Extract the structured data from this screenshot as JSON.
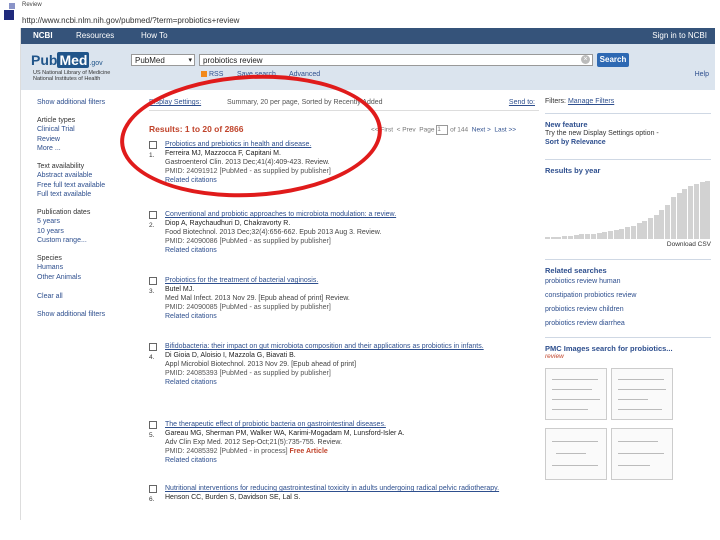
{
  "slide": {
    "top_text": "Review",
    "url_text": "http://www.ncbi.nlm.nih.gov/pubmed/?term=probiotics+review"
  },
  "ncbi_bar": {
    "logo": "NCBI",
    "resources": "Resources",
    "how_to": "How To",
    "sign_in": "Sign in to NCBI"
  },
  "header": {
    "logo_pub": "Pub",
    "logo_med": "Med",
    "logo_gov": ".gov",
    "nlm_text": "US National Library of Medicine National Institutes of Health",
    "database": "PubMed",
    "search_value": "probiotics review",
    "search_button": "Search",
    "rss": "RSS",
    "save_search": "Save search",
    "advanced": "Advanced",
    "help": "Help"
  },
  "sidebar": {
    "show_filters": "Show additional filters",
    "article_types_title": "Article types",
    "article_types": [
      "Clinical Trial",
      "Review",
      "More ..."
    ],
    "text_avail_title": "Text availability",
    "text_avail": [
      "Abstract available",
      "Free full text available",
      "Full text available"
    ],
    "pub_dates_title": "Publication dates",
    "pub_dates": [
      "5 years",
      "10 years",
      "Custom range..."
    ],
    "species_title": "Species",
    "species": [
      "Humans",
      "Other Animals"
    ],
    "clear_all": "Clear all",
    "show_filters_bottom": "Show additional filters"
  },
  "main": {
    "display_settings": "Display Settings:",
    "display_desc": "Summary, 20 per page, Sorted by Recently Added",
    "send_to": "Send to:",
    "results_count": "Results: 1 to 20 of 2866",
    "pager": {
      "first": "<< First",
      "prev": "< Prev",
      "page_label": "Page",
      "page_value": "1",
      "of": "of 144",
      "next": "Next >",
      "last": "Last >>"
    },
    "results": [
      {
        "num": "1.",
        "title": "Probiotics and prebiotics in health and disease.",
        "authors": "Ferreira MJ, Mazzocca F, Capitani M.",
        "cite": "Gastroenterol Clin. 2013 Dec;41(4):409-423. Review.",
        "pmid": "PMID: 24091912 [PubMed - as supplied by publisher]",
        "related": "Related citations",
        "free": ""
      },
      {
        "num": "2.",
        "title": "Conventional and probiotic approaches to microbiota modulation: a review.",
        "authors": "Diop A, Raychaudhuri D, Chakravorty R.",
        "cite": "Food Biotechnol. 2013 Dec;32(4):656-662. Epub 2013 Aug 3. Review.",
        "pmid": "PMID: 24090086 [PubMed - as supplied by publisher]",
        "related": "Related citations",
        "free": ""
      },
      {
        "num": "3.",
        "title": "Probiotics for the treatment of bacterial vaginosis.",
        "authors": "Butel MJ.",
        "cite": "Med Mal Infect. 2013 Nov 29. [Epub ahead of print] Review.",
        "pmid": "PMID: 24090085 [PubMed - as supplied by publisher]",
        "related": "Related citations",
        "free": ""
      },
      {
        "num": "4.",
        "title": "Bifidobacteria: their impact on gut microbiota composition and their applications as probiotics in infants.",
        "authors": "Di Gioia D, Aloisio I, Mazzola G, Biavati B.",
        "cite": "Appl Microbiol Biotechnol. 2013 Nov 29. [Epub ahead of print]",
        "pmid": "PMID: 24085393 [PubMed - as supplied by publisher]",
        "related": "Related citations",
        "free": ""
      },
      {
        "num": "5.",
        "title": "The therapeutic effect of probiotic bacteria on gastrointestinal diseases.",
        "authors": "Gareau MG, Sherman PM, Walker WA, Karimi-Mogadam M, Lunsford-Isler A.",
        "cite": "Adv Clin Exp Med. 2012 Sep-Oct;21(5):735-755. Review.",
        "pmid": "PMID: 24085392 [PubMed - in process]",
        "related": "Related citations",
        "free": "Free Article"
      },
      {
        "num": "6.",
        "title": "Nutritional interventions for reducing gastrointestinal toxicity in adults undergoing radical pelvic radiotherapy.",
        "authors": "Henson CC, Burden S, Davidson SE, Lal S.",
        "cite": "",
        "pmid": "",
        "related": "",
        "free": ""
      }
    ]
  },
  "right": {
    "filters_label": "Filters:",
    "manage_filters": "Manage Filters",
    "new_feature_title": "New feature",
    "new_feature_text": "Try the new Display Settings option -",
    "new_feature_link": "Sort by Relevance",
    "results_by_year_title": "Results by year",
    "download_csv": "Download CSV",
    "year_counts": [
      3,
      4,
      4,
      5,
      6,
      7,
      8,
      8,
      9,
      10,
      12,
      14,
      16,
      18,
      20,
      23,
      27,
      31,
      36,
      42,
      50,
      58,
      72,
      80,
      86,
      91,
      95,
      98,
      100
    ],
    "related_searches_title": "Related searches",
    "related_searches": [
      "probiotics review human",
      "constipation probiotics review",
      "probiotics review children",
      "probiotics review diarrhea"
    ],
    "pmc_title": "PMC Images search for probiotics...",
    "pmc_sub": "review"
  },
  "colors": {
    "ncbi_bar": "#35537a",
    "header_bg": "#dbe4ee",
    "link": "#2e4f8e",
    "results_count": "#c0432a",
    "annotation_ellipse": "#e01b1b",
    "search_button": "#2e69b3"
  }
}
